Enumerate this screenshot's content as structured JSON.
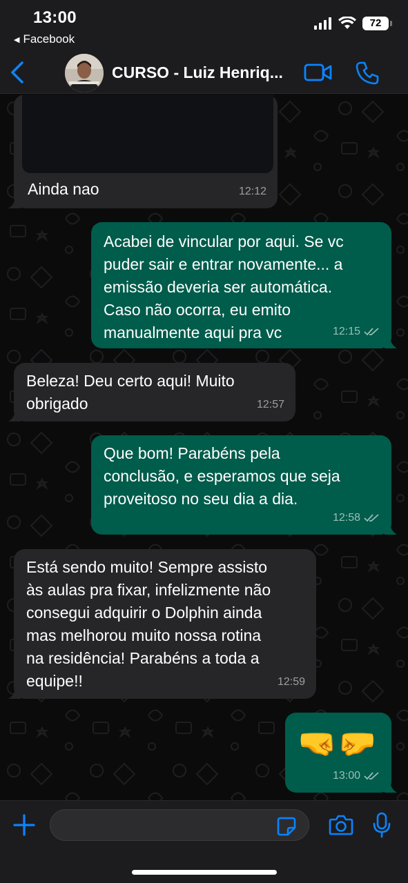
{
  "status_bar": {
    "time": "13:00",
    "back_app": "Facebook",
    "battery": "72"
  },
  "header": {
    "title": "CURSO - Luiz Henriq...",
    "accent_color": "#0a84ff"
  },
  "messages": [
    {
      "direction": "in",
      "text": "Ainda nao",
      "time": "12:12"
    },
    {
      "direction": "out",
      "text": "Acabei de vincular por aqui.  Se vc\npuder sair e entrar novamente... a\nemissão deveria ser automática.\nCaso não ocorra, eu emito\nmanualmente aqui pra vc",
      "time": "12:15",
      "read": true
    },
    {
      "direction": "in",
      "text": "Beleza! Deu certo aqui! Muito\nobrigado",
      "time": "12:57"
    },
    {
      "direction": "out",
      "text": "Que bom! Parabéns pela\nconclusão, e esperamos que seja\nproveitoso no seu dia a dia.",
      "time": "12:58",
      "read": true
    },
    {
      "direction": "in",
      "text": "Está sendo muito! Sempre assisto\nàs aulas pra fixar, infelizmente não\nconsegui adquirir o Dolphin ainda\nmas melhorou muito nossa rotina\nna residência! Parabéns a toda a\nequipe!!",
      "time": "12:59"
    },
    {
      "direction": "out",
      "text": "🤜🤛",
      "time": "13:00",
      "read": true
    }
  ],
  "composer": {
    "placeholder": "",
    "value": ""
  }
}
